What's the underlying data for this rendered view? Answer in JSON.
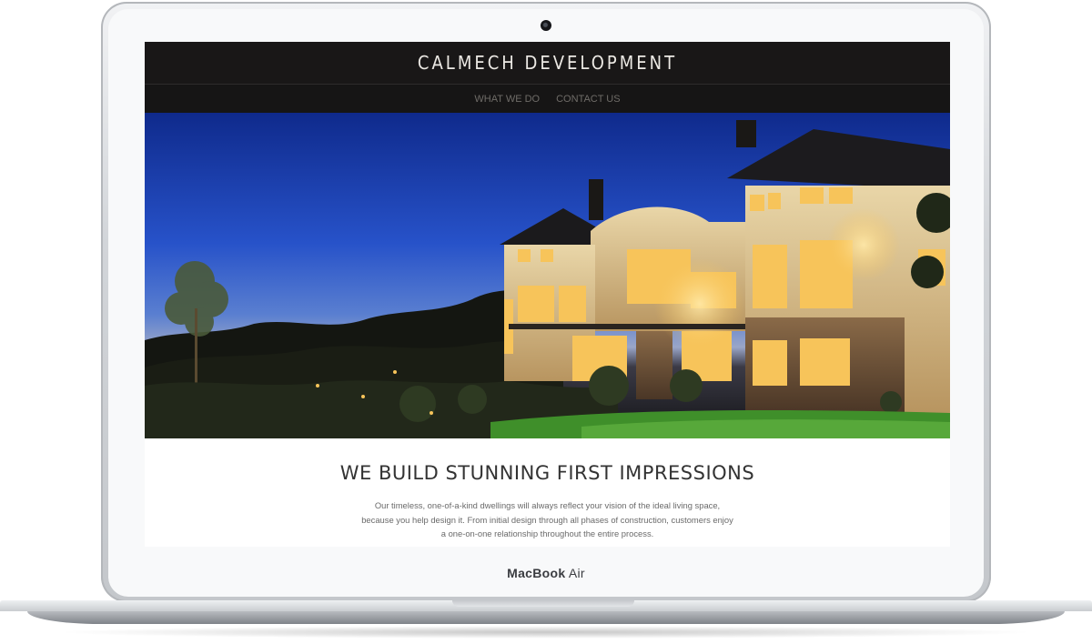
{
  "device": {
    "brand_bold": "MacBook",
    "brand_light": "Air"
  },
  "site": {
    "title": "CALMECH DEVELOPMENT",
    "nav": [
      {
        "label": "WHAT WE DO"
      },
      {
        "label": "CONTACT US"
      }
    ],
    "headline": "WE BUILD STUNNING FIRST IMPRESSIONS",
    "body": "Our timeless, one-of-a-kind dwellings will always reflect your vision of the ideal living space, because you help design it. From initial design through all phases of construction, customers enjoy a one-on-one relationship throughout the entire process."
  },
  "colors": {
    "header_bg": "#191717",
    "sky_top": "#0f2a8c",
    "window_glow": "#f7c45a",
    "lawn": "#3f8f2a"
  }
}
